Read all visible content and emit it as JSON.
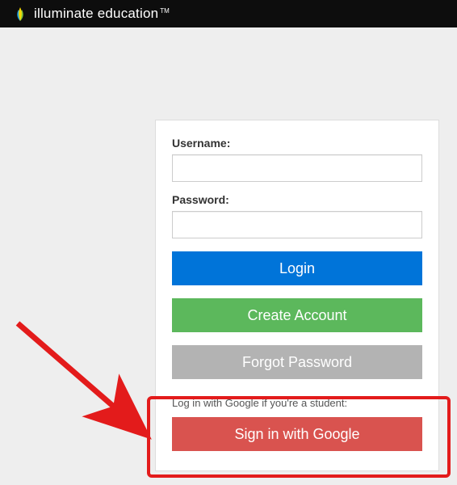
{
  "header": {
    "brand_name": "illuminate education",
    "trademark": "TM"
  },
  "form": {
    "username_label": "Username:",
    "password_label": "Password:",
    "login_button": "Login",
    "create_account_button": "Create Account",
    "forgot_password_button": "Forgot Password"
  },
  "google": {
    "hint": "Log in with Google if you're a student:",
    "button": "Sign in with Google"
  },
  "colors": {
    "primary": "#0074d9",
    "success": "#5cb85c",
    "muted": "#b3b3b3",
    "danger": "#d9534f",
    "highlight": "#e31b1b"
  }
}
